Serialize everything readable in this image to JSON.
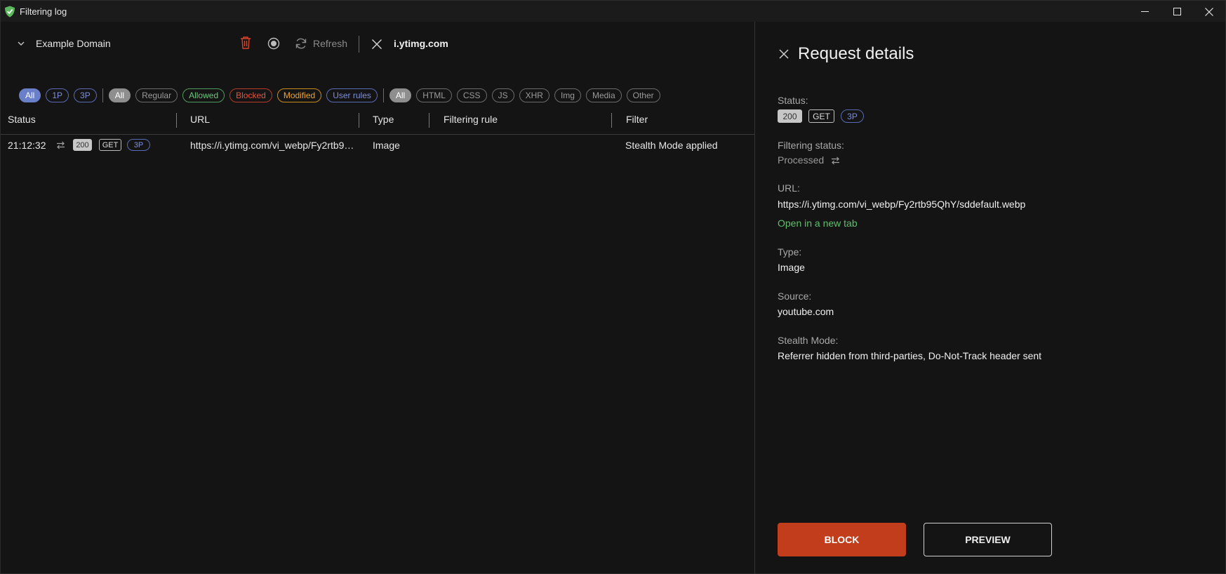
{
  "window": {
    "title": "Filtering log"
  },
  "toolbar": {
    "domain": "Example Domain",
    "refresh_label": "Refresh",
    "search_value": "i.ytimg.com"
  },
  "filters": {
    "party": [
      {
        "label": "All",
        "active": true
      },
      {
        "label": "1P",
        "active": false
      },
      {
        "label": "3P",
        "active": false
      }
    ],
    "status": [
      {
        "label": "All",
        "active": true,
        "color": "grey"
      },
      {
        "label": "Regular",
        "active": false,
        "color": "grey"
      },
      {
        "label": "Allowed",
        "active": false,
        "color": "green"
      },
      {
        "label": "Blocked",
        "active": false,
        "color": "red"
      },
      {
        "label": "Modified",
        "active": false,
        "color": "orange"
      },
      {
        "label": "User rules",
        "active": false,
        "color": "purple"
      }
    ],
    "type": [
      {
        "label": "All",
        "active": true
      },
      {
        "label": "HTML",
        "active": false
      },
      {
        "label": "CSS",
        "active": false
      },
      {
        "label": "JS",
        "active": false
      },
      {
        "label": "XHR",
        "active": false
      },
      {
        "label": "Img",
        "active": false
      },
      {
        "label": "Media",
        "active": false
      },
      {
        "label": "Other",
        "active": false
      }
    ]
  },
  "table": {
    "headers": {
      "status": "Status",
      "url": "URL",
      "type": "Type",
      "rule": "Filtering rule",
      "filter": "Filter"
    },
    "rows": [
      {
        "time": "21:12:32",
        "code": "200",
        "method": "GET",
        "party": "3P",
        "url": "https://i.ytimg.com/vi_webp/Fy2rtb9…",
        "type": "Image",
        "rule": "",
        "filter": "Stealth Mode applied"
      }
    ]
  },
  "details": {
    "title": "Request details",
    "status_label": "Status:",
    "status_code": "200",
    "status_method": "GET",
    "status_party": "3P",
    "filtering_status_label": "Filtering status:",
    "filtering_status_value": "Processed",
    "url_label": "URL:",
    "url_value": "https://i.ytimg.com/vi_webp/Fy2rtb95QhY/sddefault.webp",
    "open_link": "Open in a new tab",
    "type_label": "Type:",
    "type_value": "Image",
    "source_label": "Source:",
    "source_value": "youtube.com",
    "stealth_label": "Stealth Mode:",
    "stealth_value": "Referrer hidden from third-parties, Do-Not-Track header sent",
    "block_button": "BLOCK",
    "preview_button": "PREVIEW"
  },
  "colors": {
    "accent_block": "#c23d1c",
    "link_green": "#5fbf6c",
    "chip_blue": "#6a7fc9"
  }
}
